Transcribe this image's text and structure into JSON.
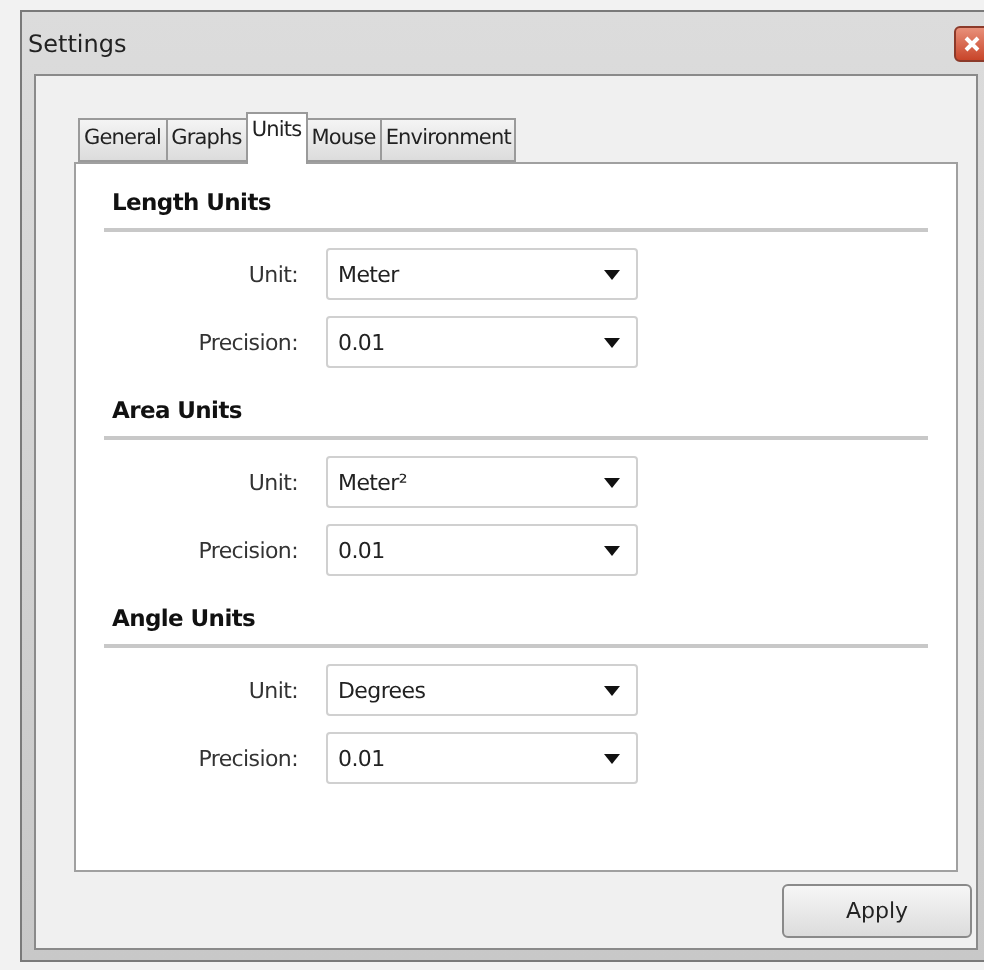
{
  "window": {
    "title": "Settings"
  },
  "tabs": [
    {
      "label": "General",
      "selected": false
    },
    {
      "label": "Graphs",
      "selected": false
    },
    {
      "label": "Units",
      "selected": true
    },
    {
      "label": "Mouse",
      "selected": false
    },
    {
      "label": "Environment",
      "selected": false
    }
  ],
  "sections": [
    {
      "title": "Length Units",
      "fields": [
        {
          "label": "Unit:",
          "value": "Meter"
        },
        {
          "label": "Precision:",
          "value": "0.01"
        }
      ]
    },
    {
      "title": "Area Units",
      "fields": [
        {
          "label": "Unit:",
          "value": "Meter²"
        },
        {
          "label": "Precision:",
          "value": "0.01"
        }
      ]
    },
    {
      "title": "Angle Units",
      "fields": [
        {
          "label": "Unit:",
          "value": "Degrees"
        },
        {
          "label": "Precision:",
          "value": "0.01"
        }
      ]
    }
  ],
  "buttons": [
    "Apply"
  ]
}
